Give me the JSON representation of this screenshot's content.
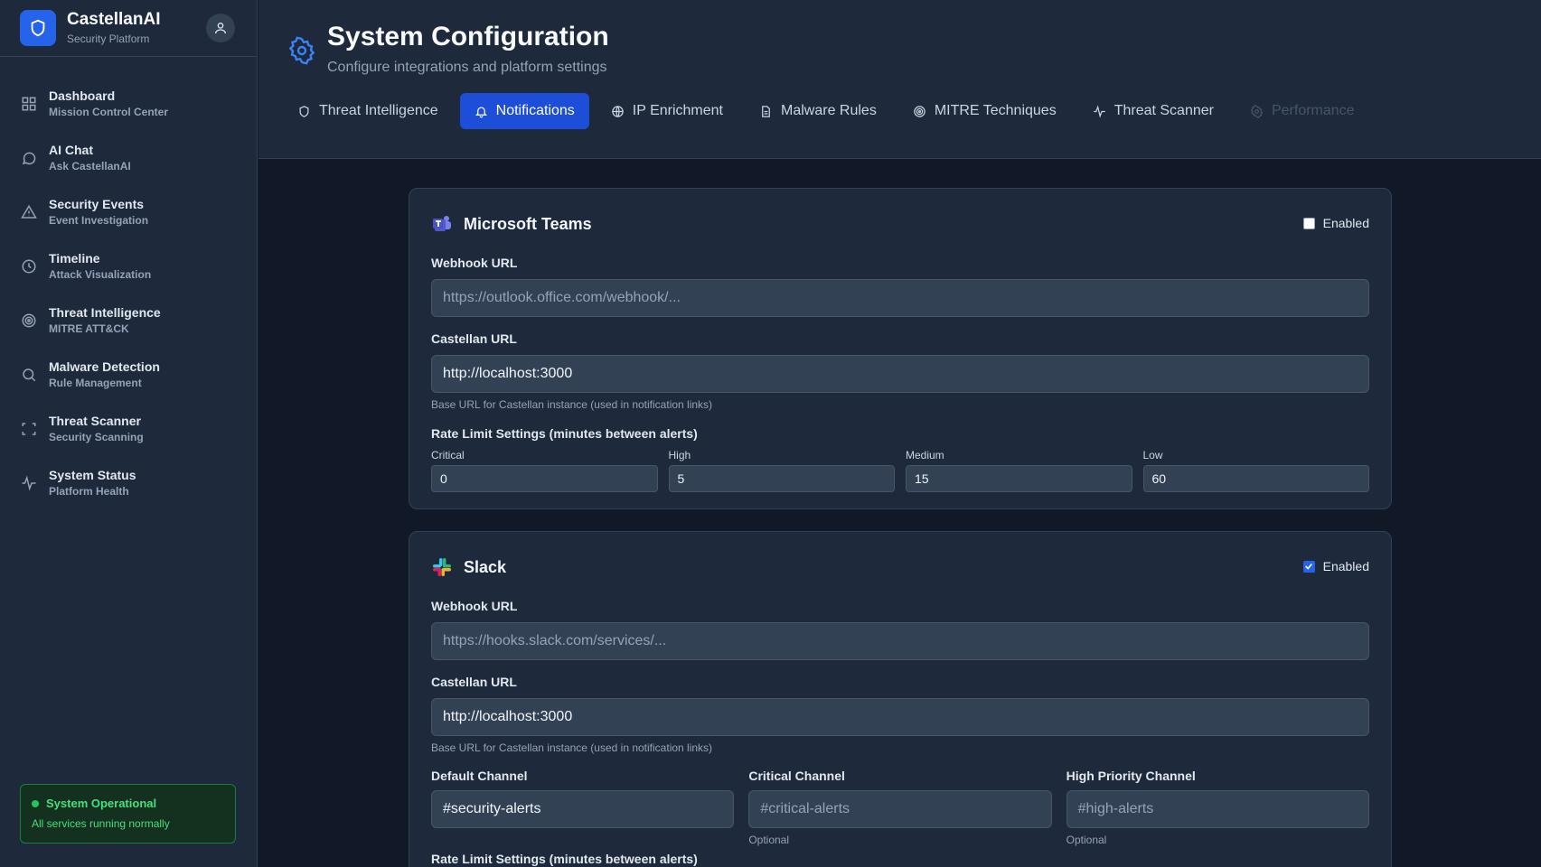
{
  "brand": {
    "name": "CastellanAI",
    "subtitle": "Security Platform"
  },
  "nav": [
    {
      "title": "Dashboard",
      "sub": "Mission Control Center",
      "icon": "grid-icon"
    },
    {
      "title": "AI Chat",
      "sub": "Ask CastellanAI",
      "icon": "chat-icon"
    },
    {
      "title": "Security Events",
      "sub": "Event Investigation",
      "icon": "warning-icon"
    },
    {
      "title": "Timeline",
      "sub": "Attack Visualization",
      "icon": "clock-icon"
    },
    {
      "title": "Threat Intelligence",
      "sub": "MITRE ATT&CK",
      "icon": "target-icon"
    },
    {
      "title": "Malware Detection",
      "sub": "Rule Management",
      "icon": "search-icon"
    },
    {
      "title": "Threat Scanner",
      "sub": "Security Scanning",
      "icon": "scan-icon"
    },
    {
      "title": "System Status",
      "sub": "Platform Health",
      "icon": "pulse-icon"
    }
  ],
  "status": {
    "title": "System Operational",
    "sub": "All services running normally",
    "color": "#22c55e"
  },
  "header": {
    "title": "System Configuration",
    "subtitle": "Configure integrations and platform settings"
  },
  "tabs": [
    {
      "label": "Threat Intelligence",
      "icon": "shield-icon",
      "state": "normal"
    },
    {
      "label": "Notifications",
      "icon": "bell-icon",
      "state": "active"
    },
    {
      "label": "IP Enrichment",
      "icon": "globe-icon",
      "state": "normal"
    },
    {
      "label": "Malware Rules",
      "icon": "file-icon",
      "state": "normal"
    },
    {
      "label": "MITRE Techniques",
      "icon": "target-icon",
      "state": "normal"
    },
    {
      "label": "Threat Scanner",
      "icon": "pulse-icon",
      "state": "normal"
    },
    {
      "label": "Performance",
      "icon": "gear-icon",
      "state": "disabled"
    }
  ],
  "teams": {
    "title": "Microsoft Teams",
    "enabled_label": "Enabled",
    "enabled": false,
    "webhook_label": "Webhook URL",
    "webhook_placeholder": "https://outlook.office.com/webhook/...",
    "castellan_label": "Castellan URL",
    "castellan_value": "http://localhost:3000",
    "castellan_hint": "Base URL for Castellan instance (used in notification links)",
    "rate_label": "Rate Limit Settings (minutes between alerts)",
    "rates": [
      {
        "name": "Critical",
        "value": "0"
      },
      {
        "name": "High",
        "value": "5"
      },
      {
        "name": "Medium",
        "value": "15"
      },
      {
        "name": "Low",
        "value": "60"
      }
    ]
  },
  "slack": {
    "title": "Slack",
    "enabled_label": "Enabled",
    "enabled": true,
    "webhook_label": "Webhook URL",
    "webhook_placeholder": "https://hooks.slack.com/services/...",
    "castellan_label": "Castellan URL",
    "castellan_value": "http://localhost:3000",
    "castellan_hint": "Base URL for Castellan instance (used in notification links)",
    "channels": [
      {
        "label": "Default Channel",
        "value": "#security-alerts",
        "placeholder": "",
        "hint": ""
      },
      {
        "label": "Critical Channel",
        "value": "",
        "placeholder": "#critical-alerts",
        "hint": "Optional"
      },
      {
        "label": "High Priority Channel",
        "value": "",
        "placeholder": "#high-alerts",
        "hint": "Optional"
      }
    ],
    "rate_label": "Rate Limit Settings (minutes between alerts)"
  },
  "colors": {
    "accent": "#2563eb",
    "active_tab": "#1d4ed8",
    "background": "#111827",
    "panel": "#1e293b"
  }
}
